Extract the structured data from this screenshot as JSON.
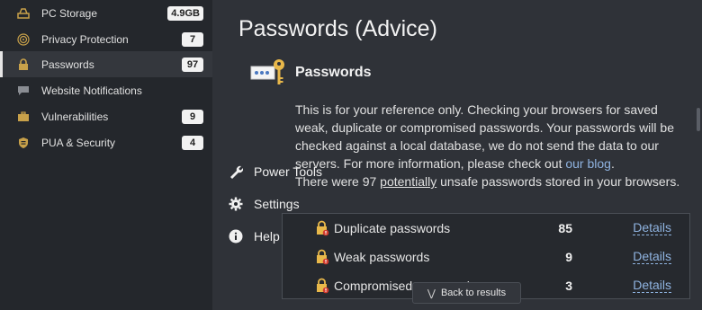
{
  "sidebar": {
    "items": [
      {
        "label": "PC Storage",
        "badge": "4.9GB",
        "icon": "storage-icon"
      },
      {
        "label": "Privacy Protection",
        "badge": "7",
        "icon": "fingerprint-icon"
      },
      {
        "label": "Passwords",
        "badge": "97",
        "icon": "lock-icon"
      },
      {
        "label": "Website Notifications",
        "badge": "",
        "icon": "chat-bubble-icon"
      },
      {
        "label": "Vulnerabilities",
        "badge": "9",
        "icon": "briefcase-icon"
      },
      {
        "label": "PUA & Security",
        "badge": "4",
        "icon": "shield-icon"
      },
      {
        "label": "Power Tools",
        "icon": "wrench-icon"
      },
      {
        "label": "Settings",
        "icon": "gear-icon"
      },
      {
        "label": "Help",
        "icon": "info-icon"
      }
    ],
    "active": "Passwords"
  },
  "main": {
    "title": "Passwords (Advice)",
    "section_title": "Passwords",
    "desc_text": "This is for your reference only. Checking your browsers for saved weak, duplicate or compromised passwords. Your passwords will be checked against a local database, we do not send the data to our servers. For more information, please check out ",
    "desc_link": "our blog",
    "desc_end": ".",
    "summary_prefix": "There were 97 ",
    "summary_emph": "potentially",
    "summary_suffix": " unsafe passwords stored in your browsers.",
    "results": [
      {
        "label": "Duplicate passwords",
        "count": "85",
        "details": "Details"
      },
      {
        "label": "Weak passwords",
        "count": "9",
        "details": "Details"
      },
      {
        "label": "Compromised passwords",
        "count": "3",
        "details": "Details"
      }
    ],
    "back_label": "Back to results"
  },
  "colors": {
    "sidebar_bg": "#24272c",
    "main_bg": "#2f3238",
    "link": "#8fb3e0",
    "icon_gold": "#c8a14a"
  }
}
